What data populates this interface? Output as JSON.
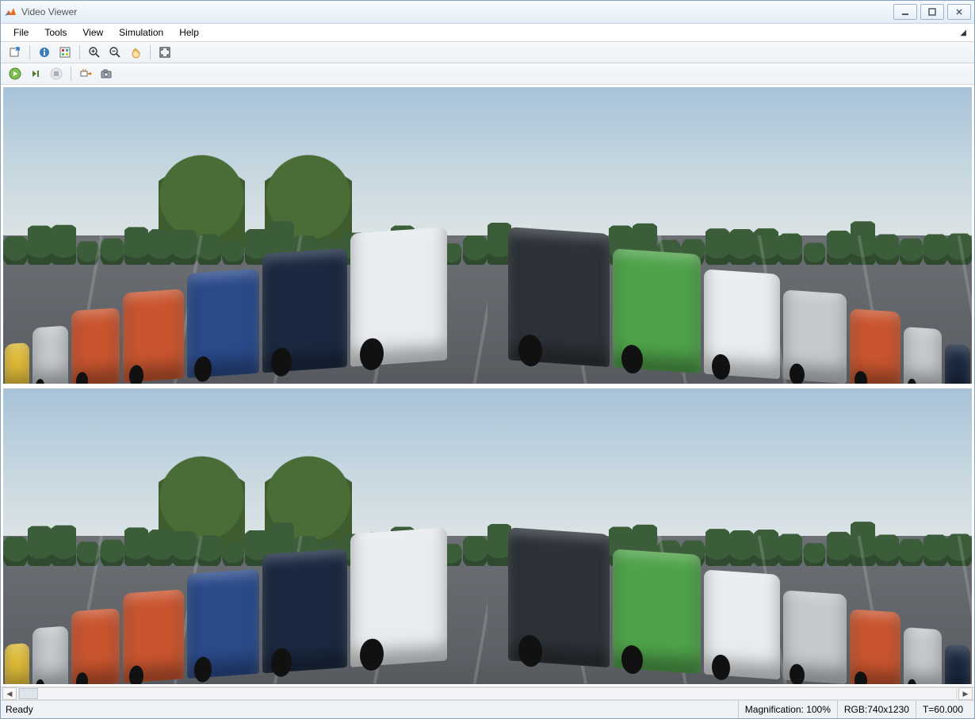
{
  "window": {
    "title": "Video Viewer"
  },
  "menu": {
    "file": "File",
    "tools": "Tools",
    "view": "View",
    "simulation": "Simulation",
    "help": "Help"
  },
  "status": {
    "ready": "Ready",
    "magnification_label": "Magnification:",
    "magnification_value": "100%",
    "rgb": "RGB:740x1230",
    "time": "T=60.000"
  },
  "colors": {
    "car_white": "#e8ecef",
    "car_navy": "#1a2940",
    "car_blue": "#2a4a8a",
    "car_orange": "#c9552f",
    "car_yellow": "#e7c23a",
    "car_green": "#4fa24a",
    "car_silver": "#c4c9cd",
    "car_darkgrey": "#2c3238"
  }
}
